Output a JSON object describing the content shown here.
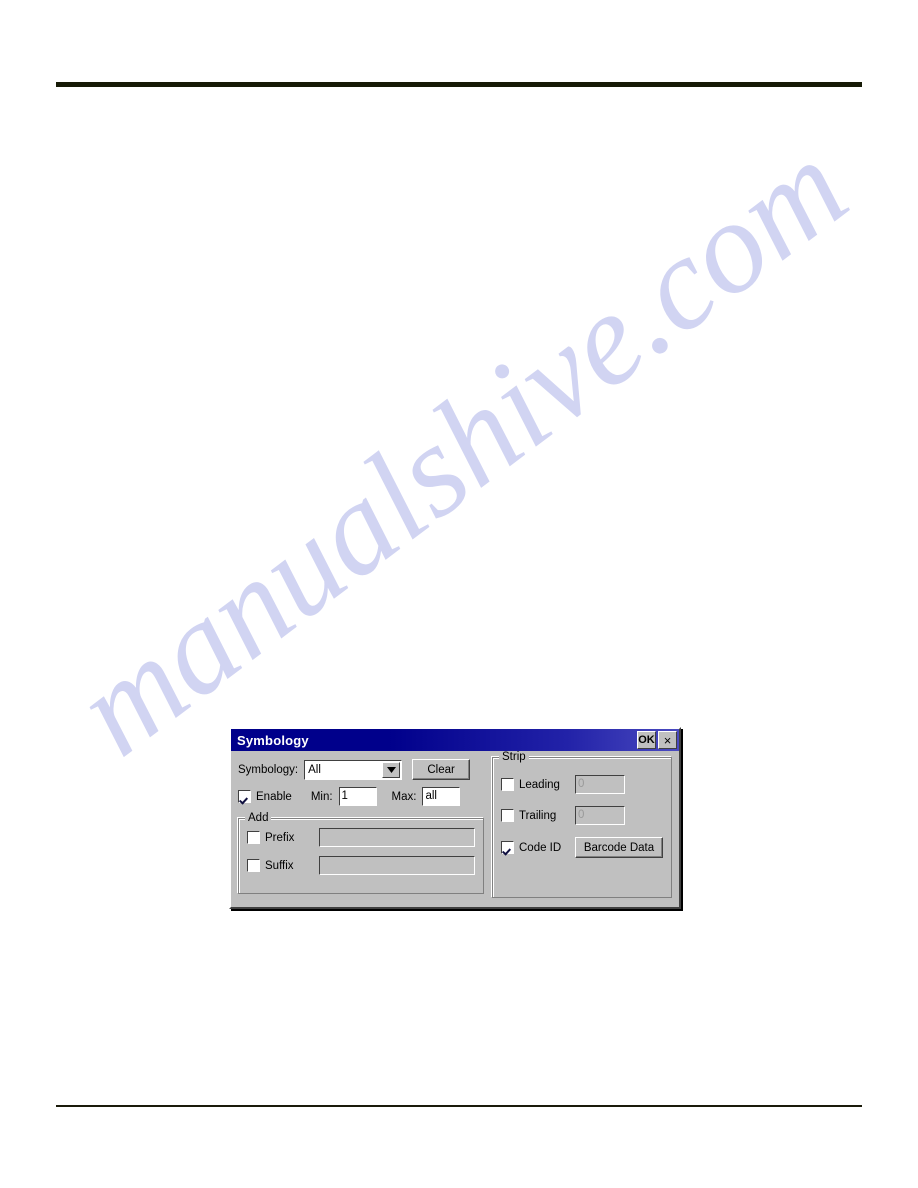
{
  "document": {
    "background_color": "#ffffff",
    "rule_color": "#161a06",
    "watermark_text": "manualshive.com",
    "watermark_color": "#c9cdf0"
  },
  "dialog": {
    "title": "Symbology",
    "titlebar_color": "#00008b",
    "face_color": "#c0c0c0",
    "buttons": {
      "ok_label": "OK",
      "close_label": "×"
    },
    "symbology_row": {
      "label": "Symbology:",
      "selected_value": "All",
      "options": [
        "All"
      ],
      "clear_label": "Clear"
    },
    "enable_row": {
      "enable_label": "Enable",
      "enable_checked": true,
      "min_label": "Min:",
      "min_value": "1",
      "max_label": "Max:",
      "max_value": "all"
    },
    "add_group": {
      "title": "Add",
      "prefix_label": "Prefix",
      "prefix_checked": false,
      "prefix_value": "",
      "suffix_label": "Suffix",
      "suffix_checked": false,
      "suffix_value": ""
    },
    "strip_group": {
      "title": "Strip",
      "leading_label": "Leading",
      "leading_checked": false,
      "leading_value": "0",
      "trailing_label": "Trailing",
      "trailing_checked": false,
      "trailing_value": "0",
      "code_id_label": "Code ID",
      "code_id_checked": true,
      "barcode_data_label": "Barcode Data"
    }
  }
}
